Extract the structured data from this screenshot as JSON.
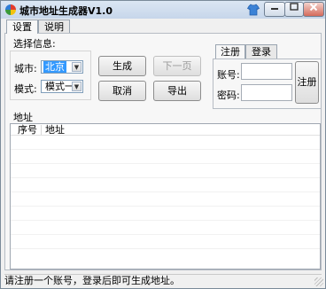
{
  "window": {
    "title": "城市地址生成器V1.0"
  },
  "tabs": [
    {
      "label": "设置"
    },
    {
      "label": "说明"
    }
  ],
  "settings": {
    "group_title": "选择信息:",
    "city_label": "城市:",
    "city_value": "北京",
    "mode_label": "模式:",
    "mode_value": "模式一"
  },
  "buttons": {
    "generate": "生成",
    "next_page": "下一页",
    "cancel": "取消",
    "export": "导出"
  },
  "auth": {
    "tabs": [
      {
        "label": "注册"
      },
      {
        "label": "登录"
      }
    ],
    "account_label": "账号:",
    "password_label": "密码:",
    "account_value": "",
    "password_value": "",
    "register_button": "注册"
  },
  "address": {
    "section_title": "地址",
    "columns": [
      "序号",
      "地址"
    ],
    "rows": []
  },
  "status": {
    "text": "请注册一个账号，登录后即可生成地址。"
  },
  "colors": {
    "accent_selection": "#3399ff",
    "titlebar": "#c6d6ea",
    "close_button": "#d46a5b"
  }
}
